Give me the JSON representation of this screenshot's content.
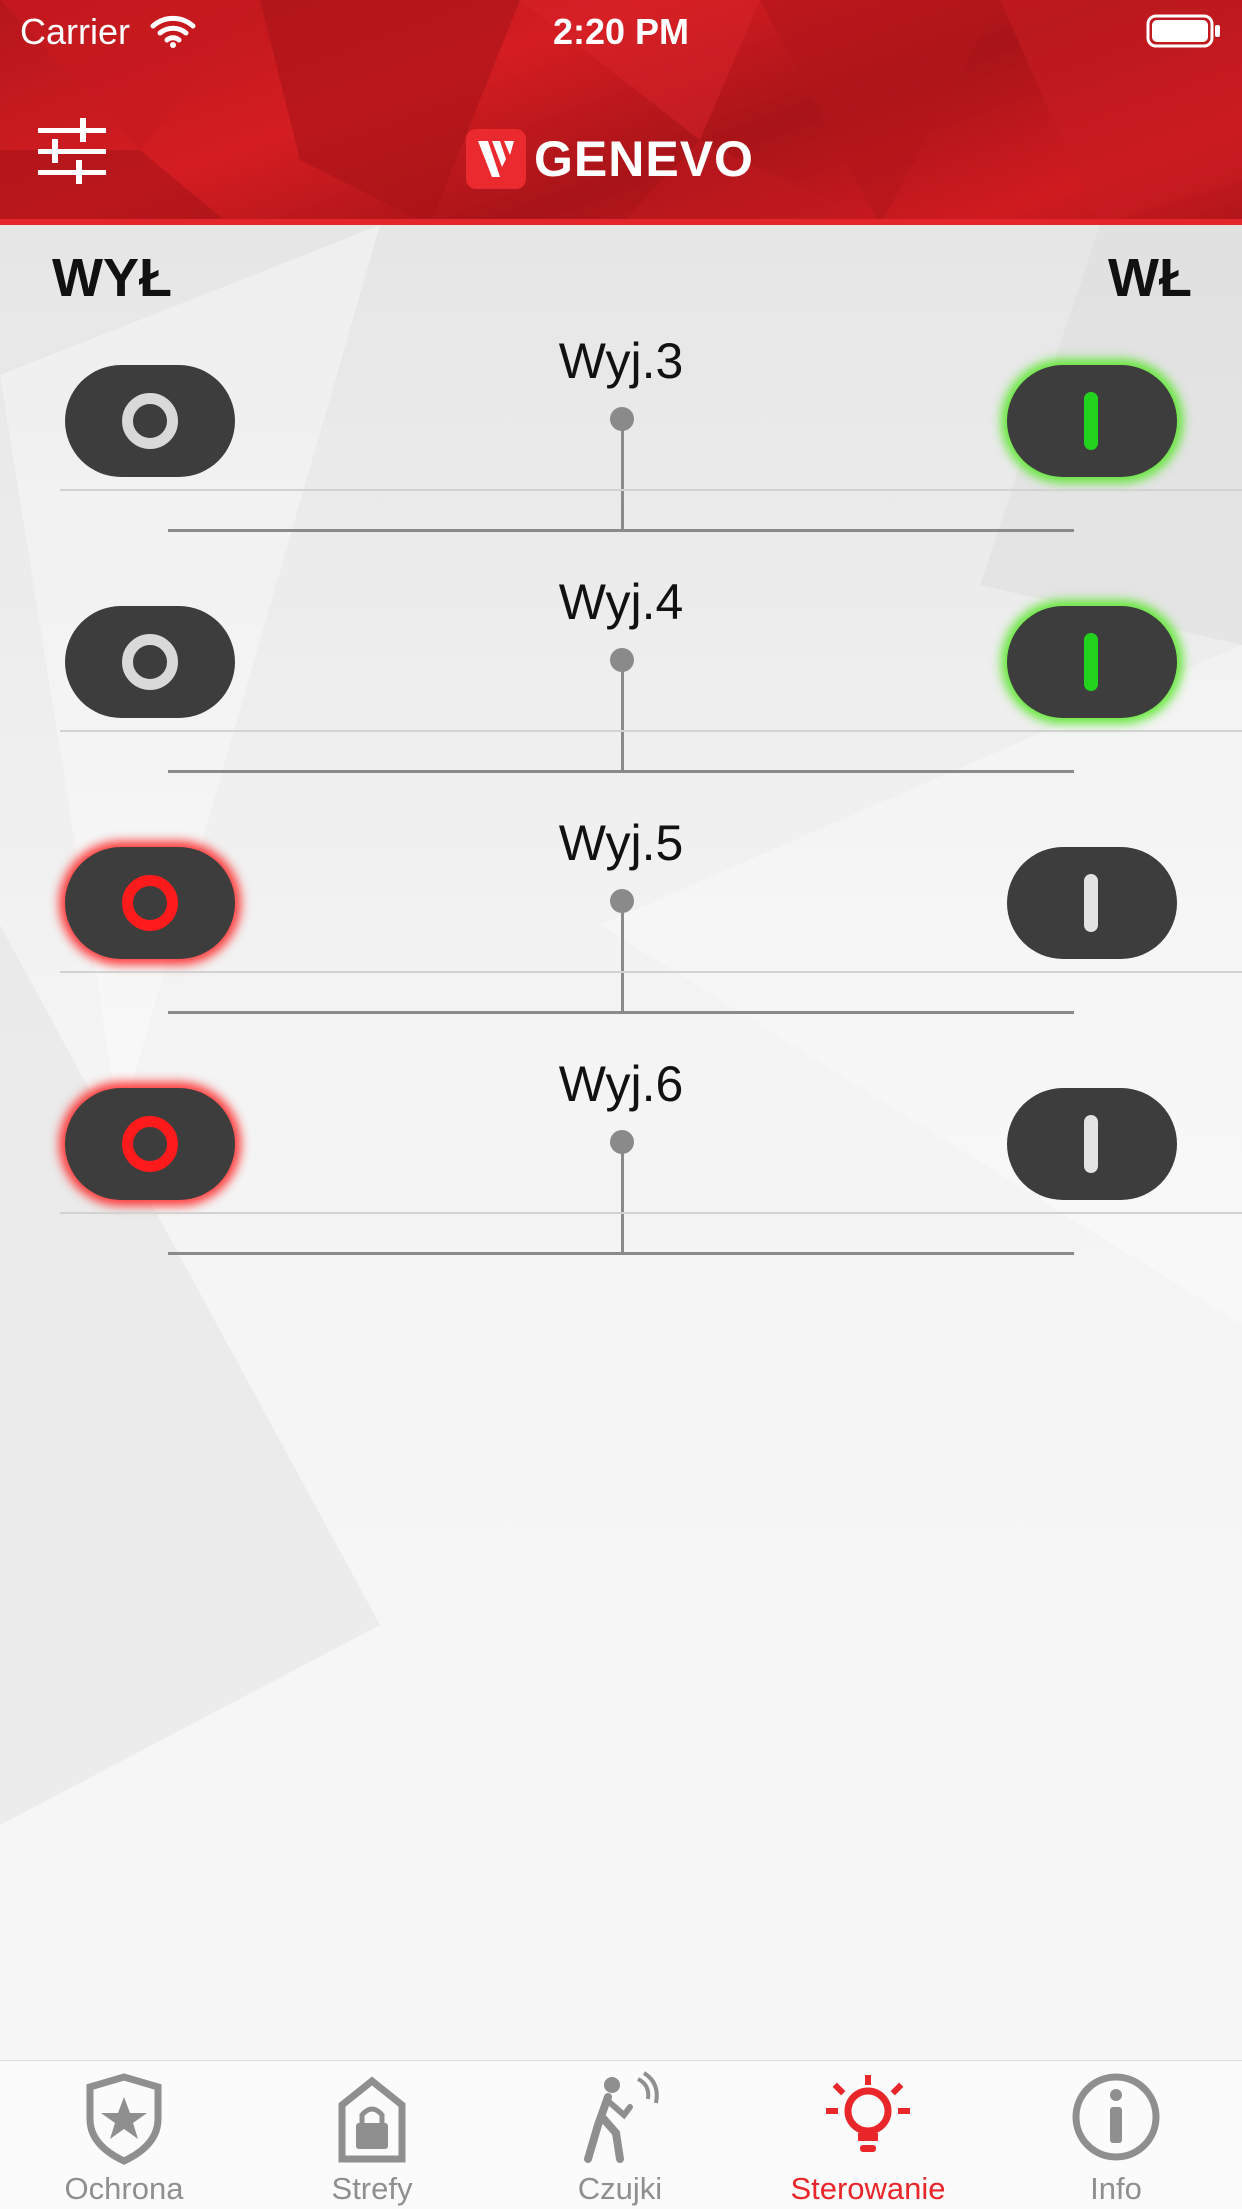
{
  "status_bar": {
    "carrier": "Carrier",
    "time": "2:20 PM"
  },
  "header": {
    "brand": "GENEVO",
    "accent_color": "#d41d22"
  },
  "columns": {
    "off_label": "WYŁ",
    "on_label": "WŁ"
  },
  "outputs": [
    {
      "name": "Wyj.3",
      "state": "on"
    },
    {
      "name": "Wyj.4",
      "state": "on"
    },
    {
      "name": "Wyj.5",
      "state": "off"
    },
    {
      "name": "Wyj.6",
      "state": "off"
    }
  ],
  "state_colors": {
    "on": "#22d31d",
    "off": "#ff1b1b",
    "idle": "#3d3d3d"
  },
  "tabs": [
    {
      "label": "Ochrona",
      "icon": "shield-star-icon",
      "active": false
    },
    {
      "label": "Strefy",
      "icon": "lock-house-icon",
      "active": false
    },
    {
      "label": "Czujki",
      "icon": "walking-sensor-icon",
      "active": false
    },
    {
      "label": "Sterowanie",
      "icon": "lightbulb-icon",
      "active": true
    },
    {
      "label": "Info",
      "icon": "info-icon",
      "active": false
    }
  ]
}
